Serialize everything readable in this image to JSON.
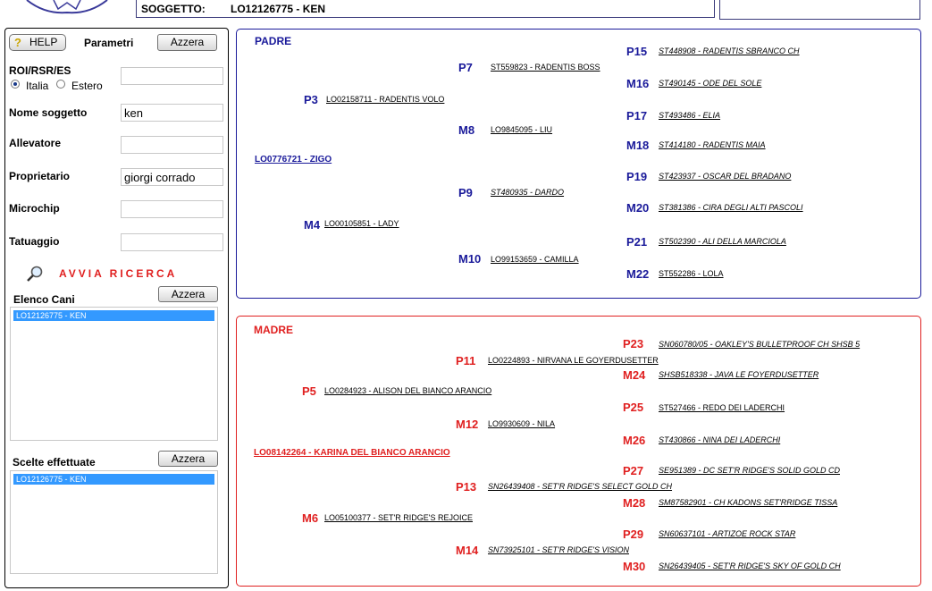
{
  "header": {
    "subject_label": "SOGGETTO:",
    "subject_value": "LO12126775 - KEN"
  },
  "left": {
    "help_label": "HELP",
    "params_title": "Parametri",
    "reset_label": "Azzera",
    "roi_label": "ROI/RSR/ES",
    "radio_italia": "Italia",
    "radio_estero": "Estero",
    "radio_selected": "Italia",
    "roi_value": "",
    "name_label": "Nome soggetto",
    "name_value": "ken",
    "breeder_label": "Allevatore",
    "breeder_value": "",
    "owner_label": "Proprietario",
    "owner_value": "giorgi corrado",
    "chip_label": "Microchip",
    "chip_value": "",
    "tattoo_label": "Tatuaggio",
    "tattoo_value": "",
    "search_label": "AVVIA RICERCA",
    "dogs_title": "Elenco Cani",
    "dogs_reset": "Azzera",
    "dogs_items": [
      "LO12126775 - KEN"
    ],
    "choices_title": "Scelte effettuate",
    "choices_reset": "Azzera",
    "choices_items": [
      "LO12126775 - KEN"
    ]
  },
  "padre": {
    "title": "PADRE",
    "root": "LO0776721 - ZIGO",
    "p3": {
      "code": "P3",
      "name": "LO02158711 - RADENTIS VOLO"
    },
    "m4": {
      "code": "M4",
      "name": "LO00105851 - LADY"
    },
    "p7": {
      "code": "P7",
      "name": "ST559823 - RADENTIS BOSS"
    },
    "m8": {
      "code": "M8",
      "name": "LO9845095 - LIU"
    },
    "p9": {
      "code": "P9",
      "name": "ST480935 - DARDO"
    },
    "m10": {
      "code": "M10",
      "name": "LO99153659 - CAMILLA"
    },
    "p15": {
      "code": "P15",
      "name": "ST448908 - RADENTIS SBRANCO CH"
    },
    "m16": {
      "code": "M16",
      "name": "ST490145 - ODE DEL SOLE"
    },
    "p17": {
      "code": "P17",
      "name": "ST493486 - ELIA"
    },
    "m18": {
      "code": "M18",
      "name": "ST414180 - RADENTIS MAIA"
    },
    "p19": {
      "code": "P19",
      "name": "ST423937 - OSCAR DEL BRADANO"
    },
    "m20": {
      "code": "M20",
      "name": "ST381386 - CIRA DEGLI ALTI PASCOLI"
    },
    "p21": {
      "code": "P21",
      "name": "ST502390 - ALI DELLA MARCIOLA"
    },
    "m22": {
      "code": "M22",
      "name": "ST552286 - LOLA"
    }
  },
  "madre": {
    "title": "MADRE",
    "root": "LO08142264 - KARINA DEL BIANCO ARANCIO",
    "p5": {
      "code": "P5",
      "name": "LO0284923 - ALISON DEL BIANCO ARANCIO"
    },
    "m6": {
      "code": "M6",
      "name": "LO05100377 - SET'R RIDGE'S REJOICE"
    },
    "p11": {
      "code": "P11",
      "name": "LO0224893 - NIRVANA LE GOYERDUSETTER"
    },
    "m12": {
      "code": "M12",
      "name": "LO9930609 - NILA"
    },
    "p13": {
      "code": "P13",
      "name": "SN26439408 - SET'R RIDGE'S SELECT GOLD CH"
    },
    "m14": {
      "code": "M14",
      "name": "SN73925101 - SET'R RIDGE'S VISION"
    },
    "p23": {
      "code": "P23",
      "name": "SN060780/05 - OAKLEY'S BULLETPROOF CH SHSB 5"
    },
    "m24": {
      "code": "M24",
      "name": "SHSB518338 - JAVA LE FOYERDUSETTER"
    },
    "p25": {
      "code": "P25",
      "name": "ST527466 - REDO DEI LADERCHI"
    },
    "m26": {
      "code": "M26",
      "name": "ST430866 - NINA DEI LADERCHI"
    },
    "p27": {
      "code": "P27",
      "name": "SE951389 - DC SET'R RIDGE'S SOLID GOLD CD"
    },
    "m28": {
      "code": "M28",
      "name": "SM87582901 - CH KADONS SET'RRIDGE TISSA"
    },
    "p29": {
      "code": "P29",
      "name": "SN60637101 - ARTIZOE ROCK STAR"
    },
    "m30": {
      "code": "M30",
      "name": "SN26439405 - SET'R RIDGE'S SKY OF GOLD CH"
    }
  },
  "colors": {
    "padre": "#1a1a9a",
    "madre": "#e02020",
    "selection": "#3399ff"
  }
}
